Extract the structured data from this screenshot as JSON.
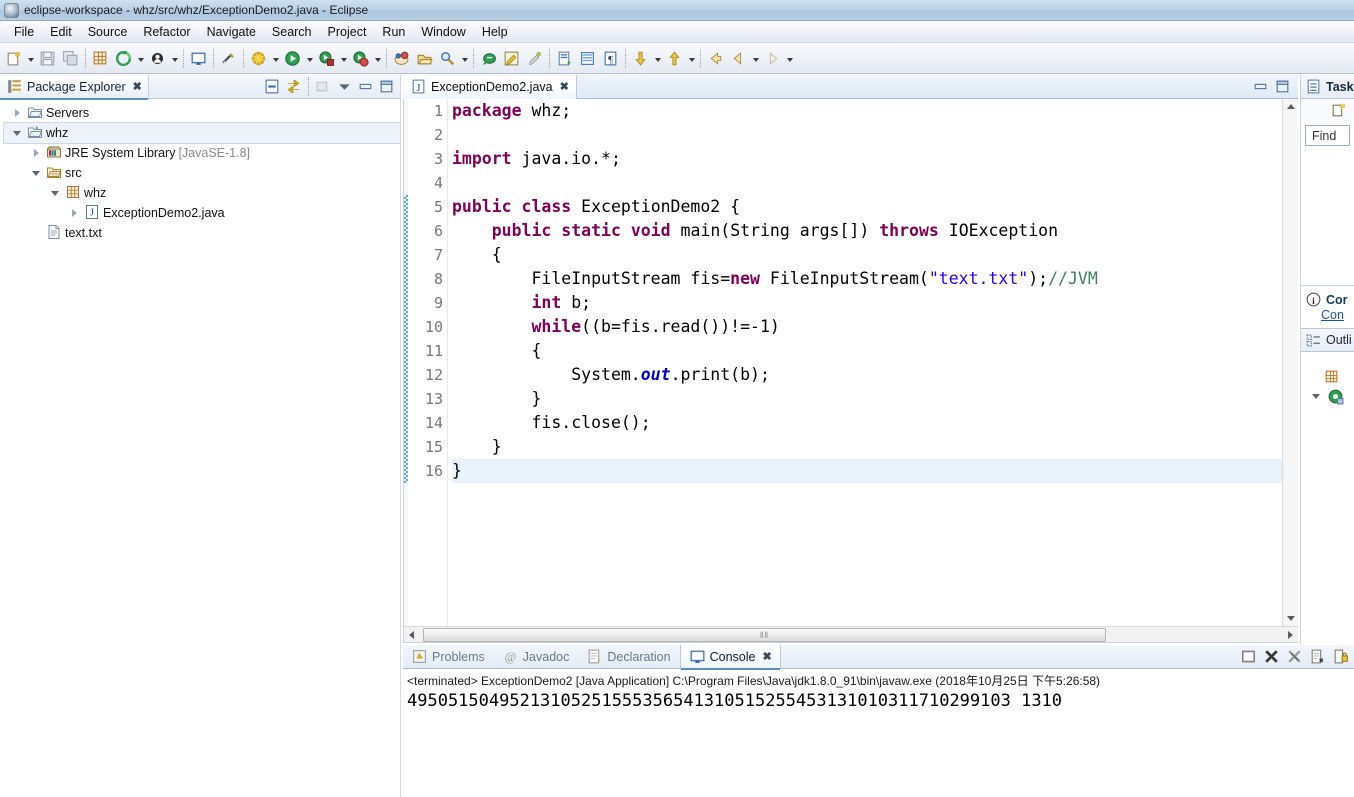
{
  "window": {
    "title": "eclipse-workspace - whz/src/whz/ExceptionDemo2.java - Eclipse",
    "icon": "eclipse-icon"
  },
  "menubar": {
    "items": [
      {
        "label": "File"
      },
      {
        "label": "Edit"
      },
      {
        "label": "Source"
      },
      {
        "label": "Refactor"
      },
      {
        "label": "Navigate"
      },
      {
        "label": "Search"
      },
      {
        "label": "Project"
      },
      {
        "label": "Run"
      },
      {
        "label": "Window"
      },
      {
        "label": "Help"
      }
    ]
  },
  "toolbar": {
    "groups": [
      {
        "buttons": [
          {
            "name": "new-wizard-icon",
            "arrow": true
          },
          {
            "name": "save-icon",
            "arrow": false
          },
          {
            "name": "save-all-icon",
            "arrow": false
          }
        ]
      },
      {
        "buttons": [
          {
            "name": "new-java-package-icon",
            "arrow": false
          },
          {
            "name": "build-all-icon",
            "arrow": true
          },
          {
            "name": "skip-breakpoints-icon",
            "arrow": true
          }
        ]
      },
      {
        "buttons": [
          {
            "name": "open-console-icon",
            "arrow": false
          }
        ]
      },
      {
        "buttons": [
          {
            "name": "toggle-breakpoint-icon",
            "arrow": false
          }
        ]
      },
      {
        "buttons": [
          {
            "name": "debug-icon",
            "arrow": true
          },
          {
            "name": "run-icon",
            "arrow": true
          },
          {
            "name": "run-external-tools-icon",
            "arrow": true
          },
          {
            "name": "coverage-icon",
            "arrow": true
          }
        ]
      },
      {
        "buttons": [
          {
            "name": "new-java-project-icon",
            "arrow": false
          },
          {
            "name": "open-type-icon",
            "arrow": false
          },
          {
            "name": "search-icon",
            "arrow": true
          }
        ]
      },
      {
        "buttons": [
          {
            "name": "open-task-icon",
            "arrow": false
          },
          {
            "name": "pencil-highlight-icon",
            "arrow": false
          },
          {
            "name": "toggle-mark-occurrences-icon",
            "arrow": false
          }
        ]
      },
      {
        "buttons": [
          {
            "name": "new-xml-icon",
            "arrow": false
          },
          {
            "name": "table-icon",
            "arrow": false
          },
          {
            "name": "paragraph-icon",
            "arrow": false
          }
        ]
      },
      {
        "buttons": [
          {
            "name": "next-annotation-icon",
            "arrow": true
          },
          {
            "name": "previous-annotation-icon",
            "arrow": true
          }
        ]
      },
      {
        "buttons": [
          {
            "name": "back-icon",
            "arrow": false
          },
          {
            "name": "forward-history-icon",
            "arrow": true
          },
          {
            "name": "forward-icon",
            "arrow": true
          }
        ]
      }
    ]
  },
  "package_explorer": {
    "tab_label": "Package Explorer",
    "tab_icon": "package-explorer-icon",
    "close_glyph": "✖",
    "tools": [
      {
        "name": "collapse-all-icon"
      },
      {
        "name": "link-with-editor-icon"
      },
      {
        "name": "focus-on-active-task-icon"
      },
      {
        "name": "view-menu-icon"
      },
      {
        "name": "minimize-icon"
      },
      {
        "name": "maximize-icon"
      }
    ],
    "tree": [
      {
        "label": "Servers",
        "sub": "",
        "depth": 0,
        "twisty": "collapsed",
        "icon": "folder-icon"
      },
      {
        "label": "whz",
        "sub": "",
        "depth": 0,
        "twisty": "expanded",
        "icon": "java-project-icon",
        "selected": true
      },
      {
        "label": "JRE System Library",
        "sub": " [JavaSE-1.8]",
        "depth": 1,
        "twisty": "collapsed",
        "icon": "library-icon"
      },
      {
        "label": "src",
        "sub": "",
        "depth": 1,
        "twisty": "expanded",
        "icon": "source-folder-icon"
      },
      {
        "label": "whz",
        "sub": "",
        "depth": 2,
        "twisty": "expanded",
        "icon": "package-icon"
      },
      {
        "label": "ExceptionDemo2.java",
        "sub": "",
        "depth": 3,
        "twisty": "collapsed",
        "icon": "java-file-icon"
      },
      {
        "label": "text.txt",
        "sub": "",
        "depth": 1,
        "twisty": "none",
        "icon": "text-file-icon"
      }
    ]
  },
  "editor": {
    "tab_label": "ExceptionDemo2.java",
    "tab_icon": "java-file-icon",
    "close_glyph": "✖",
    "tools": [
      {
        "name": "minimize-icon"
      },
      {
        "name": "maximize-icon"
      }
    ],
    "change_bar_start_line": 5,
    "change_bar_end_line": 16,
    "highlighted_line": 16,
    "fold_lines": [
      6
    ],
    "hscroll_thumb_glyph": "‖‖",
    "lines": [
      {
        "n": 1,
        "tokens": [
          {
            "t": "package",
            "c": "kw"
          },
          {
            "t": " whz;",
            "c": "plain"
          }
        ]
      },
      {
        "n": 2,
        "tokens": []
      },
      {
        "n": 3,
        "tokens": [
          {
            "t": "import",
            "c": "kw"
          },
          {
            "t": " java.io.*;",
            "c": "plain"
          }
        ]
      },
      {
        "n": 4,
        "tokens": []
      },
      {
        "n": 5,
        "tokens": [
          {
            "t": "public",
            "c": "kw"
          },
          {
            "t": " ",
            "c": "plain"
          },
          {
            "t": "class",
            "c": "kw"
          },
          {
            "t": " ExceptionDemo2 {",
            "c": "plain"
          }
        ]
      },
      {
        "n": 6,
        "tokens": [
          {
            "t": "    ",
            "c": "plain"
          },
          {
            "t": "public",
            "c": "kw"
          },
          {
            "t": " ",
            "c": "plain"
          },
          {
            "t": "static",
            "c": "kw"
          },
          {
            "t": " ",
            "c": "plain"
          },
          {
            "t": "void",
            "c": "kw"
          },
          {
            "t": " main(String args[]) ",
            "c": "plain"
          },
          {
            "t": "throws",
            "c": "kw"
          },
          {
            "t": " IOException",
            "c": "plain"
          }
        ]
      },
      {
        "n": 7,
        "tokens": [
          {
            "t": "    {",
            "c": "plain"
          }
        ]
      },
      {
        "n": 8,
        "tokens": [
          {
            "t": "        FileInputStream fis=",
            "c": "plain"
          },
          {
            "t": "new",
            "c": "kw"
          },
          {
            "t": " FileInputStream(",
            "c": "plain"
          },
          {
            "t": "\"text.txt\"",
            "c": "str"
          },
          {
            "t": ");",
            "c": "plain"
          },
          {
            "t": "//JVM",
            "c": "cmt"
          }
        ]
      },
      {
        "n": 9,
        "tokens": [
          {
            "t": "        ",
            "c": "plain"
          },
          {
            "t": "int",
            "c": "kw"
          },
          {
            "t": " b;",
            "c": "plain"
          }
        ]
      },
      {
        "n": 10,
        "tokens": [
          {
            "t": "        ",
            "c": "plain"
          },
          {
            "t": "while",
            "c": "kw"
          },
          {
            "t": "((b=fis.read())!=-1)",
            "c": "plain"
          }
        ]
      },
      {
        "n": 11,
        "tokens": [
          {
            "t": "        {",
            "c": "plain"
          }
        ]
      },
      {
        "n": 12,
        "tokens": [
          {
            "t": "            System.",
            "c": "plain"
          },
          {
            "t": "out",
            "c": "fld"
          },
          {
            "t": ".print(b);",
            "c": "plain"
          }
        ]
      },
      {
        "n": 13,
        "tokens": [
          {
            "t": "        }",
            "c": "plain"
          }
        ]
      },
      {
        "n": 14,
        "tokens": [
          {
            "t": "        fis.close();",
            "c": "plain"
          }
        ]
      },
      {
        "n": 15,
        "tokens": [
          {
            "t": "    }",
            "c": "plain"
          }
        ]
      },
      {
        "n": 16,
        "tokens": [
          {
            "t": "}",
            "c": "plain"
          }
        ]
      }
    ]
  },
  "console": {
    "tabs": [
      {
        "label": "Problems",
        "icon": "problems-icon",
        "active": false
      },
      {
        "label": "Javadoc",
        "icon": "javadoc-icon",
        "active": false
      },
      {
        "label": "Declaration",
        "icon": "declaration-icon",
        "active": false
      },
      {
        "label": "Console",
        "icon": "console-icon",
        "active": true
      }
    ],
    "close_glyph": "✖",
    "tools": [
      {
        "name": "display-selected-console-icon"
      },
      {
        "name": "terminate-icon"
      },
      {
        "name": "remove-all-terminated-icon"
      },
      {
        "name": "clear-console-icon"
      },
      {
        "name": "scroll-lock-icon"
      }
    ],
    "status_line": "<terminated> ExceptionDemo2 [Java Application] C:\\Program Files\\Java\\jdk1.8.0_91\\bin\\javaw.exe (2018年10月25日 下午5:26:58)",
    "output": "49505150495213105251555356541310515255453131010311710299103 1310"
  },
  "right_rail": {
    "task_list": {
      "title": "Task",
      "icon": "task-list-icon",
      "new_task_icon": "new-task-icon",
      "find_label": "Find"
    },
    "connect": {
      "title": "Cor",
      "icon": "info-icon",
      "link": "Con"
    },
    "outline": {
      "title": "Outli",
      "icon": "outline-icon",
      "rows": [
        {
          "icon": "package-icon"
        },
        {
          "icon": "class-icon",
          "twisty": "expanded"
        }
      ]
    }
  }
}
